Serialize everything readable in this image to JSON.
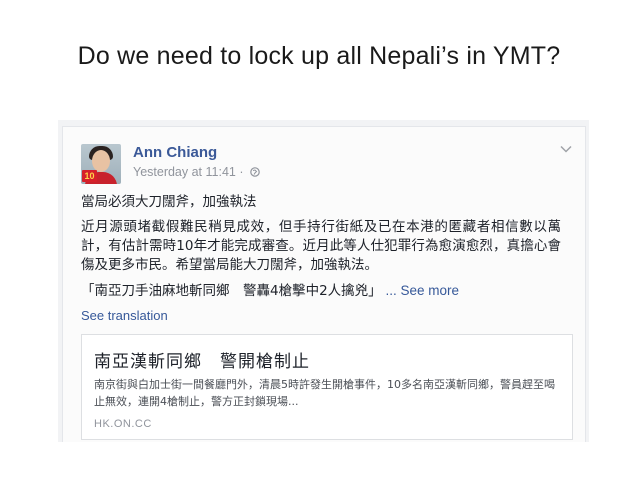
{
  "slide": {
    "title": "Do we need to lock up all Nepali’s in YMT?"
  },
  "post": {
    "author": "Ann Chiang",
    "timestamp": "Yesterday at 11:41",
    "separator": " · ",
    "avatar_badge": "10",
    "headline": "當局必須大刀闊斧，加強執法",
    "body": "近月源頭堵截假難民稍見成效，但手持行街紙及已在本港的匿藏者相信數以萬計，有估計需時10年才能完成審查。近月此等人仕犯罪行為愈演愈烈，真擔心會傷及更多市民。希望當局能大刀闊斧，加強執法。",
    "quote": "「南亞刀手油麻地斬同鄉　警轟4槍擊中2人擒兇」",
    "see_more": " ... See more",
    "see_translation": "See translation"
  },
  "link_preview": {
    "title": "南亞漢斬同鄉　警開槍制止",
    "description": "南京街與白加士街一間餐廳門外，清晨5時許發生開槍事件，10多名南亞漢斬同鄉，警員趕至喝止無效，連開4槍制止，警方正封鎖現場...",
    "domain": "HK.ON.CC"
  },
  "colors": {
    "link_blue": "#365899",
    "name_blue": "#3b5998",
    "meta_gray": "#90949c"
  },
  "icons": {
    "privacy": "globe-icon",
    "options": "chevron-down-icon"
  }
}
